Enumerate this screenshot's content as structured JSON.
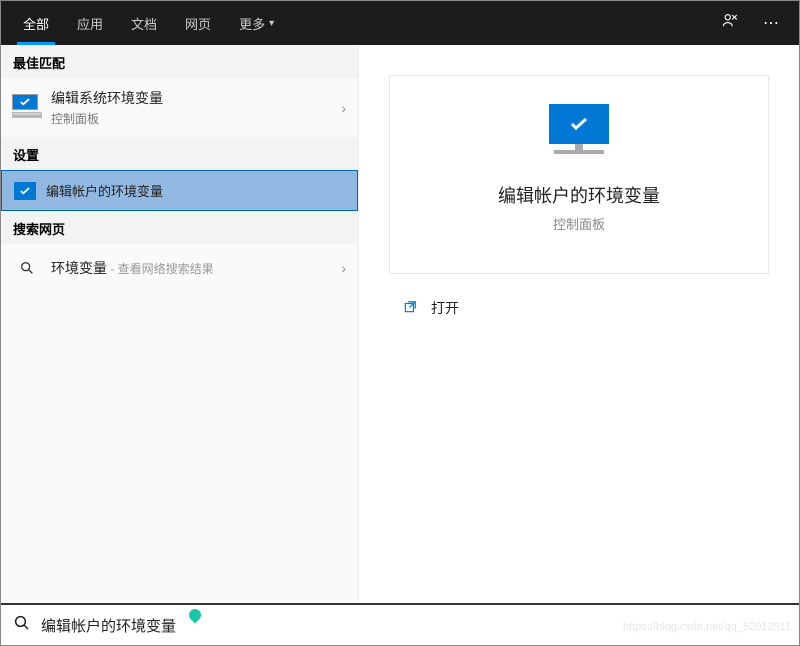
{
  "header": {
    "tabs": [
      {
        "label": "全部",
        "active": true
      },
      {
        "label": "应用",
        "active": false
      },
      {
        "label": "文档",
        "active": false
      },
      {
        "label": "网页",
        "active": false
      },
      {
        "label": "更多",
        "active": false,
        "dropdown": true
      }
    ]
  },
  "sections": {
    "best_match": "最佳匹配",
    "settings": "设置",
    "web": "搜索网页"
  },
  "results": {
    "best": {
      "title": "编辑系统环境变量",
      "subtitle": "控制面板"
    },
    "settings_item": {
      "title": "编辑帐户的环境变量"
    },
    "web_item": {
      "title": "环境变量",
      "hint": " - 查看网络搜索结果"
    }
  },
  "preview": {
    "title": "编辑帐户的环境变量",
    "subtitle": "控制面板",
    "open_label": "打开"
  },
  "search": {
    "value": "编辑帐户的环境变量"
  },
  "watermark": "https://blog.csdn.net/qq_52012511"
}
